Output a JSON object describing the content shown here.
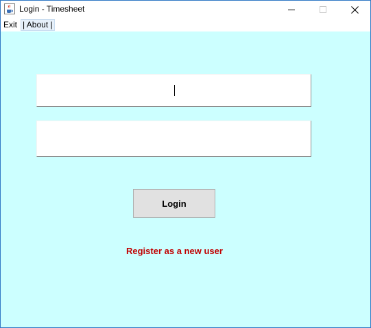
{
  "window": {
    "title": "Login - Timesheet",
    "app_icon": "java-cup-icon",
    "controls": {
      "minimize": "minimize-icon",
      "maximize": "maximize-icon",
      "close": "close-icon"
    }
  },
  "menu": {
    "exit_label": "Exit",
    "about_label": "| About |"
  },
  "form": {
    "username_value": "",
    "password_value": "",
    "login_label": "Login",
    "register_label": "Register as a new user"
  },
  "colors": {
    "background": "#ccffff",
    "register_link": "#c00000",
    "button": "#e1e1e1"
  }
}
